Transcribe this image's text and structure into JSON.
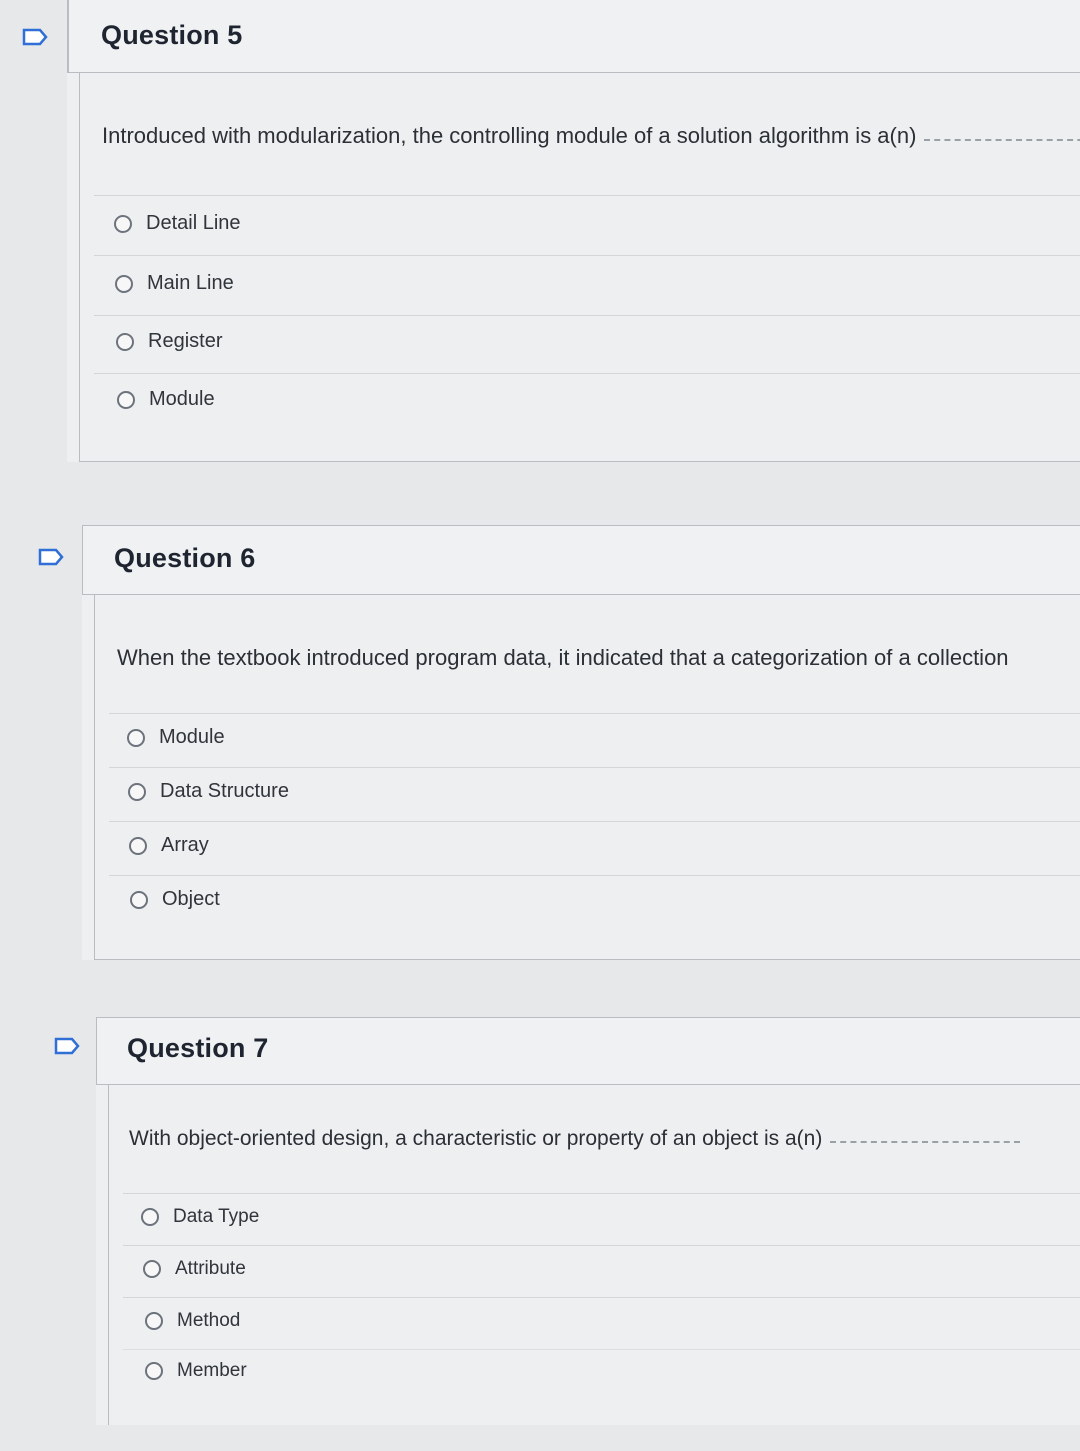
{
  "questions": [
    {
      "title": "Question 5",
      "prompt": "Introduced with modularization, the controlling module of a solution algorithm is a(n)",
      "options": [
        "Detail Line",
        "Main Line",
        "Register",
        "Module"
      ]
    },
    {
      "title": "Question 6",
      "prompt": "When the textbook introduced program data, it indicated that a categorization of a collection",
      "options": [
        "Module",
        "Data Structure",
        "Array",
        "Object"
      ]
    },
    {
      "title": "Question 7",
      "prompt": "With object-oriented design, a characteristic or property of an object is a(n)",
      "options": [
        "Data Type",
        "Attribute",
        "Method",
        "Member"
      ]
    }
  ],
  "icons": {
    "flag": "bookmark-flag-icon",
    "radio": "radio-button-icon"
  },
  "colors": {
    "flag_blue": "#2f6fd6",
    "border": "#b9bcc1"
  }
}
